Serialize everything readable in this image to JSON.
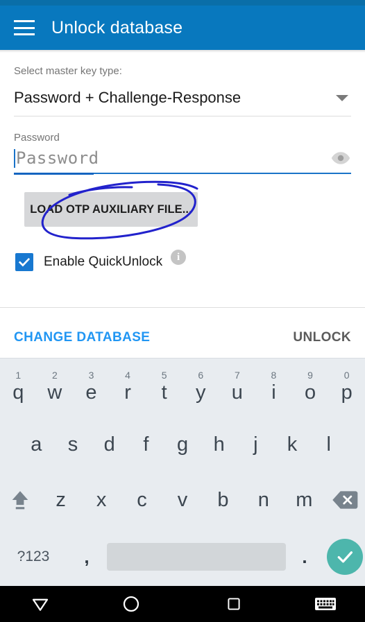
{
  "appbar": {
    "menu_icon": "hamburger-menu-icon",
    "title": "Unlock database"
  },
  "form": {
    "key_type_label": "Select master key type:",
    "key_type_value": "Password + Challenge-Response",
    "key_type_dropdown_icon": "chevron-down-icon",
    "password_label": "Password",
    "password_value": "",
    "password_placeholder": "Password",
    "reveal_icon": "eye-icon",
    "otp_button_label": "LOAD OTP AUXILIARY FILE...",
    "quickunlock_label": "Enable QuickUnlock",
    "quickunlock_checked": true,
    "info_icon": "info-icon",
    "info_icon_char": "i"
  },
  "actions": {
    "change_database_label": "CHANGE DATABASE",
    "unlock_label": "UNLOCK"
  },
  "annotation": {
    "type": "hand-drawn-ellipse",
    "color": "#2222cc",
    "target": "LOAD OTP AUXILIARY FILE..."
  },
  "colors": {
    "appbar_blue": "#0878be",
    "status_blue": "#0a6ea8",
    "accent_blue": "#1a73c8",
    "link_blue": "#2196f3",
    "checkbox_blue": "#1878d0",
    "keyboard_bg": "#e8ecf0",
    "key_text": "#3c4650",
    "enter_teal": "#4db6ac",
    "button_gray": "#d6d7d9",
    "navbar_black": "#000000"
  },
  "keyboard": {
    "row1": [
      {
        "letter": "q",
        "num": "1"
      },
      {
        "letter": "w",
        "num": "2"
      },
      {
        "letter": "e",
        "num": "3"
      },
      {
        "letter": "r",
        "num": "4"
      },
      {
        "letter": "t",
        "num": "5"
      },
      {
        "letter": "y",
        "num": "6"
      },
      {
        "letter": "u",
        "num": "7"
      },
      {
        "letter": "i",
        "num": "8"
      },
      {
        "letter": "o",
        "num": "9"
      },
      {
        "letter": "p",
        "num": "0"
      }
    ],
    "row2": [
      {
        "letter": "a"
      },
      {
        "letter": "s"
      },
      {
        "letter": "d"
      },
      {
        "letter": "f"
      },
      {
        "letter": "g"
      },
      {
        "letter": "h"
      },
      {
        "letter": "j"
      },
      {
        "letter": "k"
      },
      {
        "letter": "l"
      }
    ],
    "row3": [
      {
        "letter": "z"
      },
      {
        "letter": "x"
      },
      {
        "letter": "c"
      },
      {
        "letter": "v"
      },
      {
        "letter": "b"
      },
      {
        "letter": "n"
      },
      {
        "letter": "m"
      }
    ],
    "shift_icon": "shift-key-icon",
    "backspace_icon": "backspace-key-icon",
    "symbols_label": "?123",
    "comma_label": ",",
    "space_label": "",
    "period_label": ".",
    "enter_icon": "checkmark-enter-icon"
  },
  "navbar": {
    "back_icon": "back-triangle-icon",
    "home_icon": "home-circle-icon",
    "recents_icon": "recents-square-icon",
    "keyboard_toggle_icon": "keyboard-toggle-icon"
  }
}
